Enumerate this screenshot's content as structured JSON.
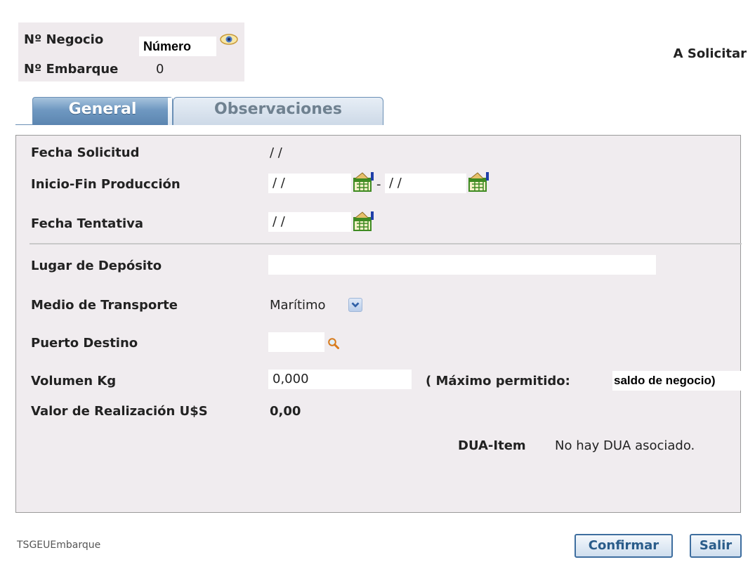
{
  "header": {
    "negocio_label": "Nº Negocio",
    "negocio_value": "Número",
    "embarque_label": "Nº Embarque",
    "embarque_value": "0",
    "status": "A Solicitar"
  },
  "tabs": [
    {
      "label": "General",
      "active": true
    },
    {
      "label": "Observaciones",
      "active": false
    }
  ],
  "form": {
    "fecha_solicitud_label": "Fecha Solicitud",
    "fecha_solicitud_value": "/ /",
    "inicio_fin_label": "Inicio-Fin Producción",
    "inicio_value": "/ /",
    "range_separator": "-",
    "fin_value": "/ /",
    "fecha_tentativa_label": "Fecha Tentativa",
    "fecha_tentativa_value": "/ /",
    "lugar_deposito_label": "Lugar de Depósito",
    "lugar_deposito_value": "",
    "medio_transporte_label": "Medio de Transporte",
    "medio_transporte_value": "Marítimo",
    "puerto_destino_label": "Puerto Destino",
    "puerto_destino_value": "",
    "volumen_label": "Volumen Kg",
    "volumen_value": "0,000",
    "maximo_label": "( Máximo permitido:",
    "maximo_value": "saldo de negocio)",
    "valor_label": "Valor de Realización U$S",
    "valor_value": "0,00",
    "dua_label": "DUA-Item",
    "dua_value": "No hay DUA asociado."
  },
  "footer": {
    "form_id": "TSGEUEmbarque",
    "confirm_label": "Confirmar",
    "exit_label": "Salir"
  },
  "icons": {
    "eye": "eye-icon",
    "calendar": "calendar-icon",
    "search": "search-icon",
    "dropdown": "chevron-down-icon"
  },
  "colors": {
    "tab_active": "#5b85b0",
    "panel_bg": "#f0ecef",
    "button_text": "#2a5c8a"
  }
}
